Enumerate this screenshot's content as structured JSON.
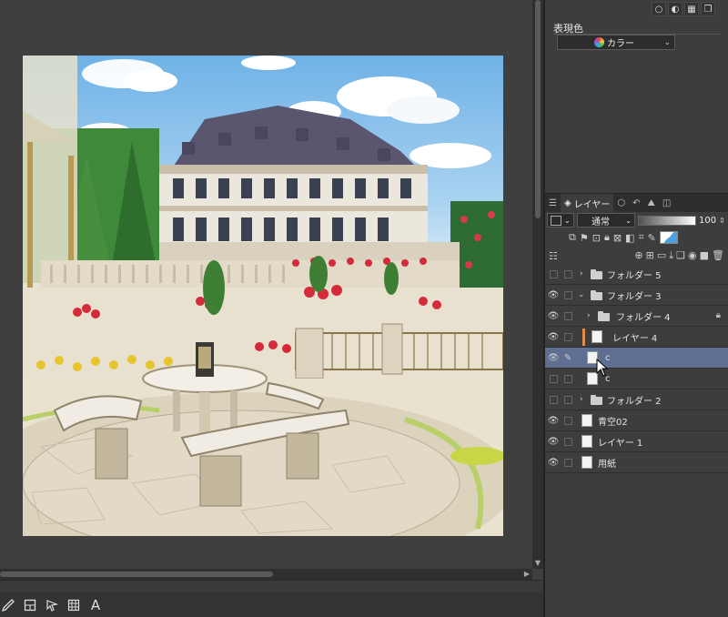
{
  "color_panel": {
    "expression_label": "表現色",
    "expression_value": "カラー"
  },
  "layer_panel": {
    "tab_label": "レイヤー",
    "blend_mode": "通常",
    "opacity": "100",
    "layers": [
      {
        "name": "フォルダー 5",
        "type": "folder",
        "visible": false,
        "expanded": false
      },
      {
        "name": "フォルダー 3",
        "type": "folder",
        "visible": true,
        "expanded": true
      },
      {
        "name": "フォルダー 4",
        "type": "folder",
        "visible": true,
        "expanded": false,
        "locked": true
      },
      {
        "name": "レイヤー 4",
        "type": "layer",
        "visible": true
      },
      {
        "name": "c",
        "type": "layer",
        "visible": true,
        "selected": true
      },
      {
        "name": "c",
        "type": "layer",
        "visible": false
      },
      {
        "name": "フォルダー 2",
        "type": "folder",
        "visible": false,
        "expanded": false
      },
      {
        "name": "青空02",
        "type": "layer",
        "visible": true
      },
      {
        "name": "レイヤー 1",
        "type": "layer",
        "visible": true
      },
      {
        "name": "用紙",
        "type": "paper",
        "visible": true
      }
    ]
  },
  "colors": {
    "selected_row": "#5f6f91",
    "panel_bg": "#3d3d3d",
    "canvas_bg": "#3f3f3f"
  },
  "icons": {
    "bottom_toolbar": [
      "pen-icon",
      "layer-property-icon",
      "select-arrow-icon",
      "grid-icon",
      "text-icon"
    ],
    "text_tool_glyph": "A"
  }
}
